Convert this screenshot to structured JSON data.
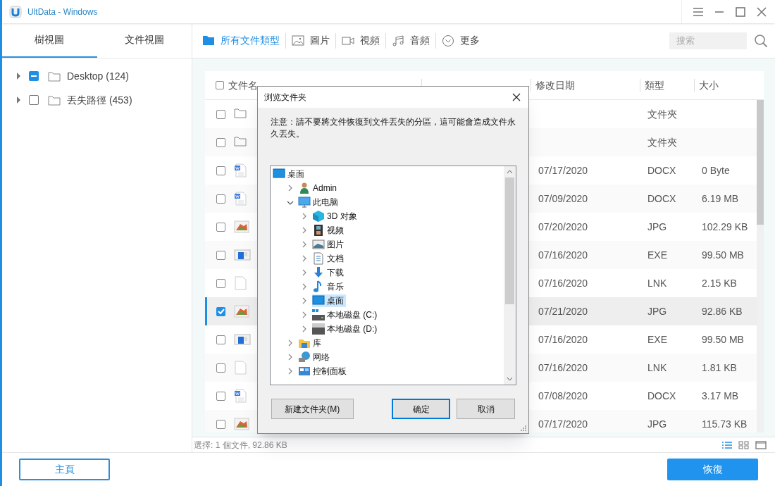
{
  "window": {
    "title": "UltData - Windows"
  },
  "view_tabs": [
    {
      "label": "樹視圖",
      "selected": true
    },
    {
      "label": "文件視圖",
      "selected": false
    }
  ],
  "tree": [
    {
      "label": "Desktop (124)",
      "indeterminate": true
    },
    {
      "label": "丟失路徑 (453)",
      "indeterminate": false
    }
  ],
  "categories": [
    {
      "kind": "folder",
      "label": "所有文件類型",
      "selected": true
    },
    {
      "kind": "image",
      "label": "圖片",
      "selected": false
    },
    {
      "kind": "video",
      "label": "視頻",
      "selected": false
    },
    {
      "kind": "audio",
      "label": "音頻",
      "selected": false
    },
    {
      "kind": "more",
      "label": "更多",
      "selected": false
    }
  ],
  "search": {
    "placeholder": "搜索"
  },
  "table": {
    "all_checked": false,
    "columns": [
      "文件名",
      "修改日期",
      "類型",
      "大小"
    ],
    "rows": [
      {
        "kind": "folder",
        "checked": false,
        "selected": false,
        "modified": "",
        "type": "文件夾",
        "size": ""
      },
      {
        "kind": "folder",
        "checked": false,
        "selected": false,
        "modified": "",
        "type": "文件夾",
        "size": ""
      },
      {
        "kind": "word",
        "checked": false,
        "selected": false,
        "modified": "07/17/2020",
        "type": "DOCX",
        "size": "0 Byte"
      },
      {
        "kind": "word",
        "checked": false,
        "selected": false,
        "modified": "07/09/2020",
        "type": "DOCX",
        "size": "6.19 MB"
      },
      {
        "kind": "picture",
        "checked": false,
        "selected": false,
        "modified": "07/20/2020",
        "type": "JPG",
        "size": "102.29 KB"
      },
      {
        "kind": "exe",
        "checked": false,
        "selected": false,
        "modified": "07/16/2020",
        "type": "EXE",
        "size": "99.50 MB"
      },
      {
        "kind": "file",
        "checked": false,
        "selected": false,
        "modified": "07/16/2020",
        "type": "LNK",
        "size": "2.15 KB"
      },
      {
        "kind": "picture",
        "checked": true,
        "selected": true,
        "modified": "07/21/2020",
        "type": "JPG",
        "size": "92.86 KB"
      },
      {
        "kind": "exe",
        "checked": false,
        "selected": false,
        "modified": "07/16/2020",
        "type": "EXE",
        "size": "99.50 MB"
      },
      {
        "kind": "file",
        "checked": false,
        "selected": false,
        "modified": "07/16/2020",
        "type": "LNK",
        "size": "1.81 KB"
      },
      {
        "kind": "word",
        "checked": false,
        "selected": false,
        "modified": "07/08/2020",
        "type": "DOCX",
        "size": "3.17 MB"
      },
      {
        "kind": "picture",
        "checked": false,
        "selected": false,
        "modified": "07/17/2020",
        "type": "JPG",
        "size": "115.73 KB"
      }
    ]
  },
  "status_bar": "選擇: 1 個文件, 92.86 KB",
  "view_modes": [
    {
      "kind": "list",
      "selected": true
    },
    {
      "kind": "grid",
      "selected": false
    },
    {
      "kind": "single",
      "selected": false
    }
  ],
  "dialog": {
    "title": "浏览文件夹",
    "note": "注意：請不要將文件恢復到文件丟失的分區，這可能會造成文件永久丟失。",
    "folders": [
      {
        "kind": "desktop",
        "label": "桌面",
        "selected": false,
        "children": [
          {
            "kind": "user",
            "label": "Admin",
            "expanded": false,
            "selected": false
          },
          {
            "kind": "pc",
            "label": "此电脑",
            "expanded": true,
            "selected": false,
            "children": [
              {
                "kind": "cube",
                "label": "3D 对象",
                "expanded": false,
                "selected": false
              },
              {
                "kind": "film",
                "label": "视频",
                "expanded": false,
                "selected": false
              },
              {
                "kind": "picture",
                "label": "图片",
                "expanded": false,
                "selected": false
              },
              {
                "kind": "document",
                "label": "文档",
                "expanded": false,
                "selected": false
              },
              {
                "kind": "download",
                "label": "下载",
                "expanded": false,
                "selected": false
              },
              {
                "kind": "music",
                "label": "音乐",
                "expanded": false,
                "selected": false
              },
              {
                "kind": "desktop",
                "label": "桌面",
                "expanded": false,
                "selected": true
              },
              {
                "kind": "drive-c",
                "label": "本地磁盘 (C:)",
                "expanded": false,
                "selected": false
              },
              {
                "kind": "drive",
                "label": "本地磁盘 (D:)",
                "expanded": false,
                "selected": false
              }
            ]
          },
          {
            "kind": "library",
            "label": "库",
            "expanded": false,
            "selected": false
          },
          {
            "kind": "network",
            "label": "网络",
            "expanded": false,
            "selected": false
          },
          {
            "kind": "control",
            "label": "控制面板",
            "expanded": false,
            "selected": false
          }
        ]
      }
    ],
    "buttons": [
      {
        "label": "新建文件夹(M)",
        "default": false
      },
      {
        "label": "确定",
        "default": true
      },
      {
        "label": "取消",
        "default": false
      }
    ]
  },
  "footer": {
    "home": "主頁",
    "recover": "恢復"
  }
}
